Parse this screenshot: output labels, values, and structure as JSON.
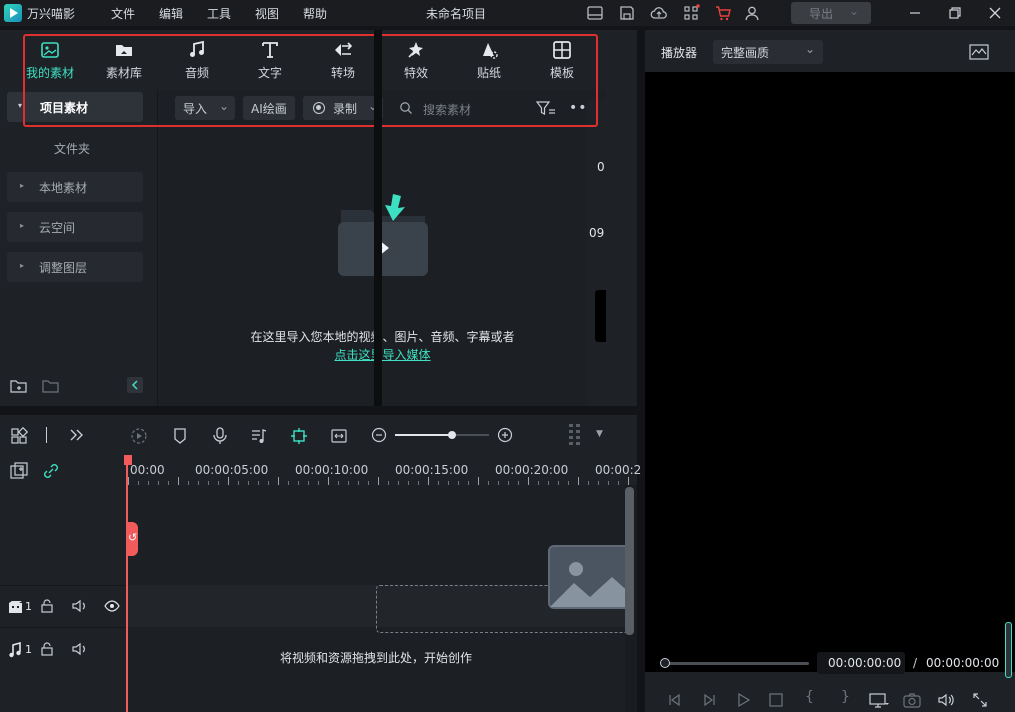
{
  "titlebar": {
    "app_name": "万兴喵影",
    "menus": [
      "文件",
      "编辑",
      "工具",
      "视图",
      "帮助"
    ],
    "project_title": "未命名项目",
    "export_label": "导出"
  },
  "media_tabs": [
    {
      "label": "我的素材",
      "icon": "my-media-icon",
      "active": true
    },
    {
      "label": "素材库",
      "icon": "stock-library-icon",
      "active": false
    },
    {
      "label": "音频",
      "icon": "music-note-icon",
      "active": false
    },
    {
      "label": "文字",
      "icon": "text-T-icon",
      "active": false
    },
    {
      "label": "转场",
      "icon": "transition-icon",
      "active": false
    },
    {
      "label": "特效",
      "icon": "effects-sparkle-icon",
      "active": false
    },
    {
      "label": "贴纸",
      "icon": "sticker-icon",
      "active": false
    },
    {
      "label": "模板",
      "icon": "template-grid-icon",
      "active": false
    }
  ],
  "sidebar": {
    "active_item": "项目素材",
    "folder_label": "文件夹",
    "items": [
      "本地素材",
      "云空间",
      "调整图层"
    ]
  },
  "toolbar": {
    "import_label": "导入",
    "ai_paint_label": "AI绘画",
    "record_label": "录制",
    "search_placeholder": "搜索素材"
  },
  "empty_state": {
    "message": "在这里导入您本地的视频、图片、音频、字幕或者",
    "link_part1": "点击这里",
    "link_part2": "导入媒体"
  },
  "partial_overlap": {
    "digit_top": "0",
    "digit_mid": "09"
  },
  "player": {
    "tab_label": "播放器",
    "quality_label": "完整画质",
    "current_time": "00:00:00:00",
    "separator": "/",
    "total_time": "00:00:00:00"
  },
  "timeline": {
    "ruler_labels": [
      "00:00",
      "00:00:05:00",
      "00:00:10:00",
      "00:00:15:00",
      "00:00:20:00",
      "00:00:2"
    ],
    "video_track_label": "1",
    "audio_track_label": "1",
    "drop_hint": "将视频和资源拖拽到此处，开始创作"
  },
  "colors": {
    "accent": "#3ee0c2",
    "highlight_box": "#e02f2f",
    "playhead": "#f25b5b"
  }
}
